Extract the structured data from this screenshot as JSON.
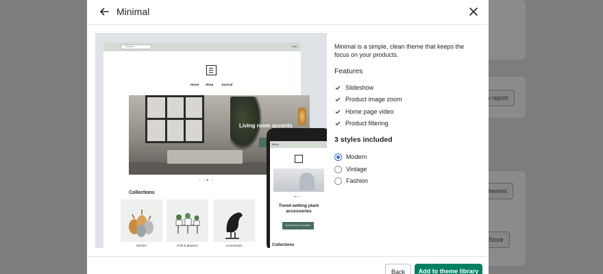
{
  "modal": {
    "title": "Minimal",
    "description": "Minimal is a simple, clean theme that keeps the focus on your products.",
    "features_heading": "Features",
    "features": [
      {
        "label": "Slideshow",
        "icon": "check-icon"
      },
      {
        "label": "Product image zoom",
        "icon": "check-icon"
      },
      {
        "label": "Home page video",
        "icon": "check-icon"
      },
      {
        "label": "Product filtering",
        "icon": "check-icon"
      }
    ],
    "styles_heading": "3 styles included",
    "styles": [
      {
        "label": "Modern",
        "selected": true
      },
      {
        "label": "Vintage",
        "selected": false
      },
      {
        "label": "Fashion",
        "selected": false
      }
    ],
    "back_label": "Back",
    "add_label": "Add to theme library"
  },
  "preview": {
    "search_placeholder": "Search",
    "cart_label": "Cart",
    "nav": [
      "Home",
      "Shop",
      "Journal"
    ],
    "hero_text": "Living room accents",
    "collections_title": "Collections",
    "collections": [
      "Kitchen",
      "Pots & planters",
      "Accessories"
    ],
    "mobile_menu": "Menu",
    "mobile_hero_text": "Trend-setting plant accessories",
    "mobile_button": "SHOP POTS & PLANTERS",
    "mobile_collections": "Collections"
  },
  "background": {
    "buttons": [
      "w report",
      "hemes",
      "Store"
    ]
  },
  "colors": {
    "primary": "#008060",
    "radio_selected": "#2c6ecb",
    "overlay_bg": "#7d7d7d"
  }
}
